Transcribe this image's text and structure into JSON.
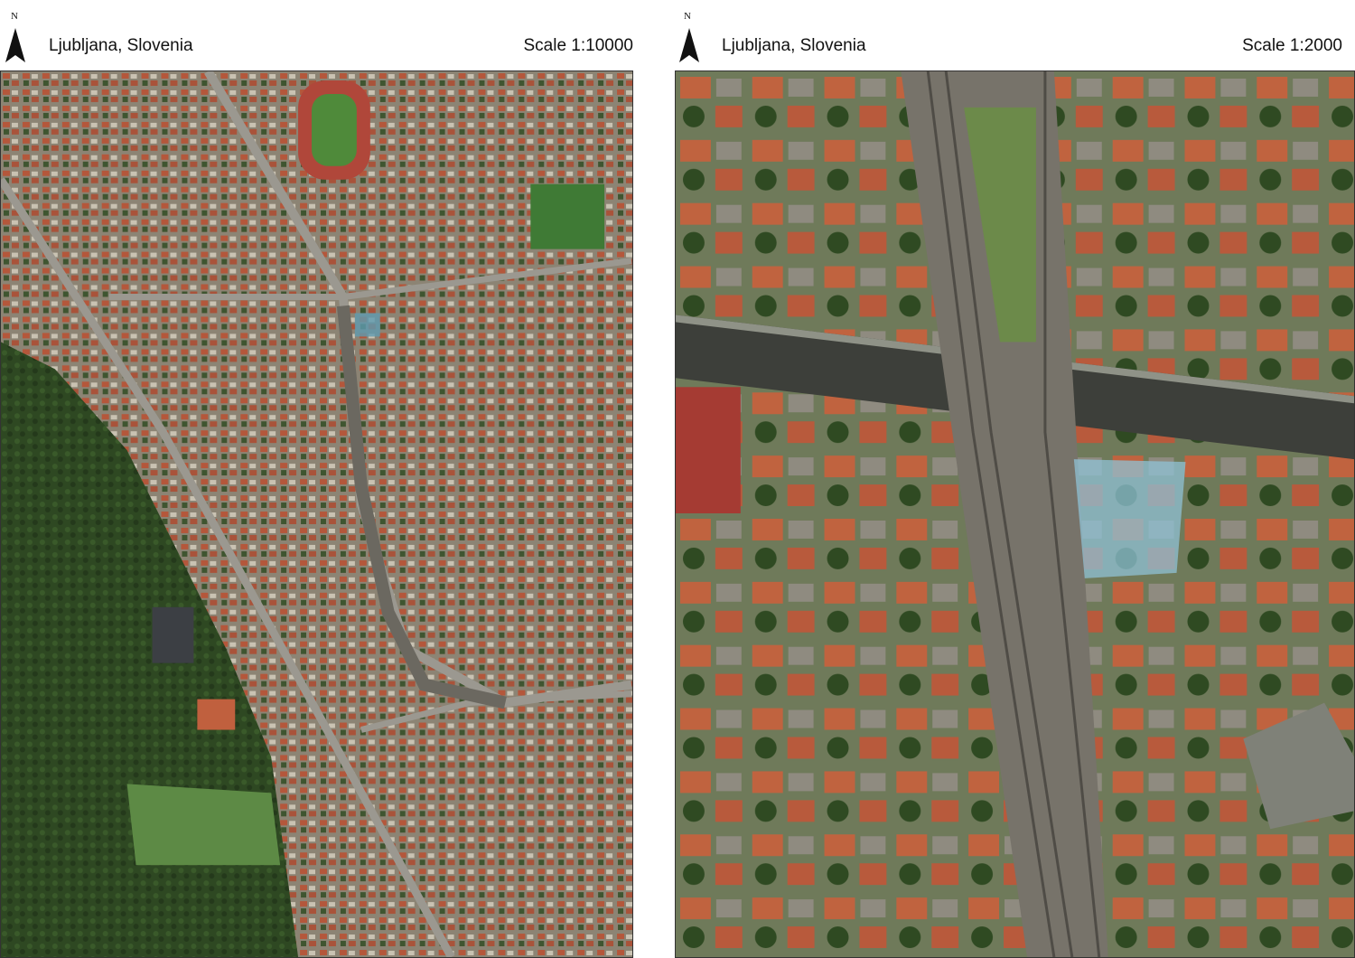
{
  "panels": [
    {
      "north_label": "N",
      "north_icon": "north-arrow-icon",
      "location": "Ljubljana, Slovenia",
      "scale": "Scale 1:10000"
    },
    {
      "north_label": "N",
      "north_icon": "north-arrow-icon",
      "location": "Ljubljana, Slovenia",
      "scale": "Scale 1:2000"
    }
  ],
  "colors": {
    "forest": "#2f4a22",
    "urban": "#8a8070",
    "roof": "#b5553a",
    "road": "#9b9890",
    "rail": "#6b6860",
    "highlight": "#8fc1d6"
  }
}
